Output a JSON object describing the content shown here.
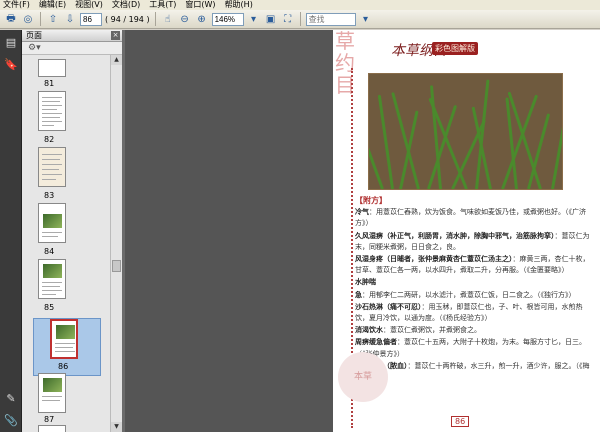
{
  "menu": [
    "文件(F)",
    "编辑(E)",
    "视图(V)",
    "文档(D)",
    "工具(T)",
    "窗口(W)",
    "帮助(H)"
  ],
  "toolbar": {
    "page_current": "86",
    "page_total": "( 94 / 194 )",
    "zoom": "146%",
    "search_placeholder": "查找"
  },
  "panel": {
    "title": "页面",
    "thumbnails": [
      {
        "label": "81"
      },
      {
        "label": "82"
      },
      {
        "label": "83"
      },
      {
        "label": "84"
      },
      {
        "label": "85"
      },
      {
        "label": "86"
      },
      {
        "label": "87"
      }
    ],
    "selected": "86"
  },
  "page": {
    "header_cal": "本草纲目",
    "header_tag": "彩色图解版",
    "section_title": "【附方】",
    "paras": [
      {
        "bold": "冷气",
        "text": "：用薏苡仁舂熟，炊为饭食。气味欲如麦饭乃佳，或煮粥也好。（《广济方》）"
      },
      {
        "bold": "久风湿痹（补正气，利肠胃，消水肿，除胸中邪气，治筋脉拘挛）",
        "text": "：薏苡仁为末，同粳米煮粥，日日食之，良。"
      },
      {
        "bold": "风湿身疼（日晡者，张仲景麻黄杏仁薏苡仁汤主之）",
        "text": "：麻黄三两，杏仁十枚，甘草、薏苡仁各一两，以水四升，煮取二升，分再服。（《金匮要略》）"
      },
      {
        "bold": "水肿喘急",
        "text": "：用郁李仁二两研，以水滤汁，煮薏苡仁饭，日二食之。（《独行方》）"
      },
      {
        "bold": "沙石热淋（痛不可忍）",
        "text": "：用玉秫，即薏苡仁也，子、叶、根皆可用，水煎热饮，夏月冷饮，以通为度。（《杨氏经验方》）"
      },
      {
        "bold": "消渴饮水",
        "text": "：薏苡仁煮粥饮，并煮粥食之。"
      },
      {
        "bold": "周痹缓急偏者",
        "text": "：薏苡仁十五两，大附子十枚炮，为末。每服方寸匕，日三。（《张仲景方》）"
      },
      {
        "bold": "肺痿咳唾（脓血）",
        "text": "：薏苡仁十两杵破，水三升，煎一升，酒少许，服之。（《梅师方》）"
      }
    ],
    "page_number": "86",
    "stamp": "本草"
  }
}
